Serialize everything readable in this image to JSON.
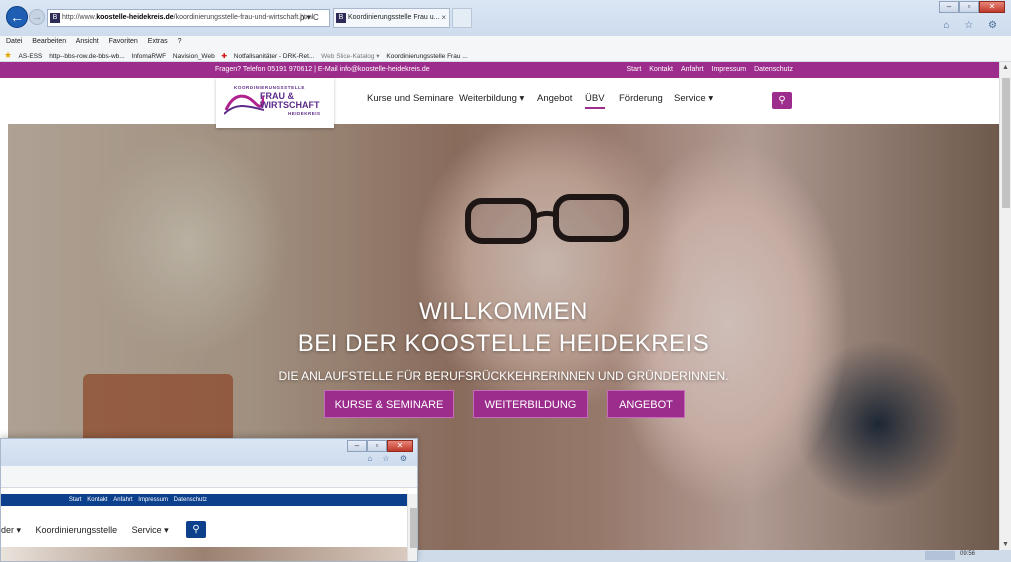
{
  "browser": {
    "url_prefix": "http://www.",
    "url_host": "koostelle-heidekreis.de",
    "url_path": "/koordinierungsstelle-frau-und-wirtschaft.html",
    "addr_tools": "ρ ▾ C",
    "tab_title": "Koordinierungsstelle Frau u...",
    "tab_close": "×",
    "tab_favicon": "B",
    "menu": [
      "Datei",
      "Bearbeiten",
      "Ansicht",
      "Favoriten",
      "Extras",
      "?"
    ],
    "favorites": [
      "AS-ESS",
      "http--bbs-row.de-bbs-wb...",
      "InfomaRWF",
      "Navision_Web",
      "Notfallsanitäter - DRK-Ret...",
      "Web Slice-Katalog ▾",
      "Koordinierungsstelle Frau ..."
    ],
    "win_buttons": [
      "–",
      "▫",
      "✕"
    ],
    "toolbar_icons": "⌂ ☆ ⚙"
  },
  "site": {
    "topbar": {
      "contact": "Fragen?     Telefon 05191 970612  |  E-Mail info@koostelle-heidekreis.de",
      "links": [
        "Start",
        "Kontakt",
        "Anfahrt",
        "Impressum",
        "Datenschutz"
      ]
    },
    "logo": {
      "line1": "KOORDINIERUNGSSTELLE",
      "line2": "FRAU &",
      "line3": "WIRTSCHAFT",
      "line4": "HEIDEKREIS"
    },
    "nav": {
      "kurse": "Kurse und Seminare",
      "weiterbildung": "Weiterbildung ▾",
      "angebot": "Angebot",
      "ubv": "ÜBV",
      "foerderung": "Förderung",
      "service": "Service ▾"
    },
    "search_icon": "⚲",
    "hero": {
      "title1": "WILLKOMMEN",
      "title2": "BEI DER KOOSTELLE HEIDEKREIS",
      "subtitle": "DIE ANLAUFSTELLE FÜR BERUFSRÜCKKEHRERINNEN UND GRÜNDERINNEN.",
      "btn1": "KURSE & SEMINARE",
      "btn2": "WEITERBILDUNG",
      "btn3": "ANGEBOT"
    },
    "accent_color": "#9d2d8c"
  },
  "second_window": {
    "topbar_links": [
      "Start",
      "Kontakt",
      "Anfahrt",
      "Impressum",
      "Datenschutz"
    ],
    "nav": [
      "der ▾",
      "Koordinierungsstelle",
      "Service ▾"
    ],
    "accent_color": "#0c3f8c"
  },
  "taskbar": {
    "time": "09:56"
  }
}
